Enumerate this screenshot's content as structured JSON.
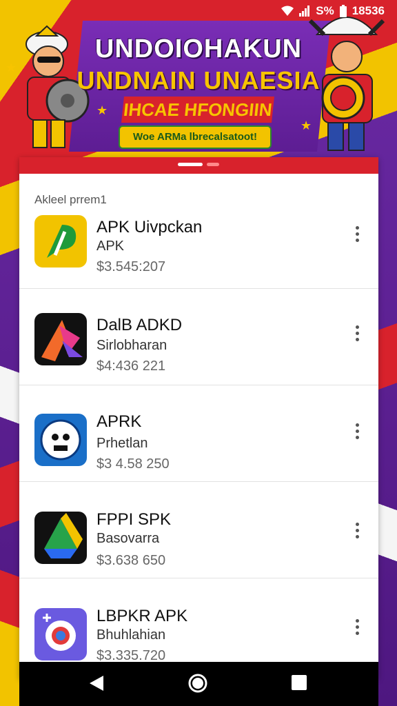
{
  "status": {
    "battery_label": "S%",
    "time": "18536"
  },
  "banner": {
    "title_line1": "UNDOIOHAKUN",
    "title_line2": "UNDNAIN UNAESIA",
    "title_line3": "IHCAE HFONGIIN",
    "pill_text": "Woe ARMa lbrecalsatoot!"
  },
  "list": {
    "section_label": "Akleel prrem1",
    "items": [
      {
        "name": "APK Uivpckan",
        "subtitle": "APK",
        "price": "$3.545:207"
      },
      {
        "name": "DalB ADKD",
        "subtitle": "Sirlobharan",
        "price": "$4:436 221"
      },
      {
        "name": "APRK",
        "subtitle": "Prhetlan",
        "price": "$3 4.58 250"
      },
      {
        "name": "FPPI SPK",
        "subtitle": "Basovarra",
        "price": "$3.638 650"
      },
      {
        "name": "LBPKR APK",
        "subtitle": "Bhuhlahian",
        "price": "$3.335.720"
      }
    ]
  },
  "colors": {
    "accent_red": "#d8222c",
    "accent_yellow": "#f2c300",
    "accent_purple": "#5b1b8a"
  }
}
